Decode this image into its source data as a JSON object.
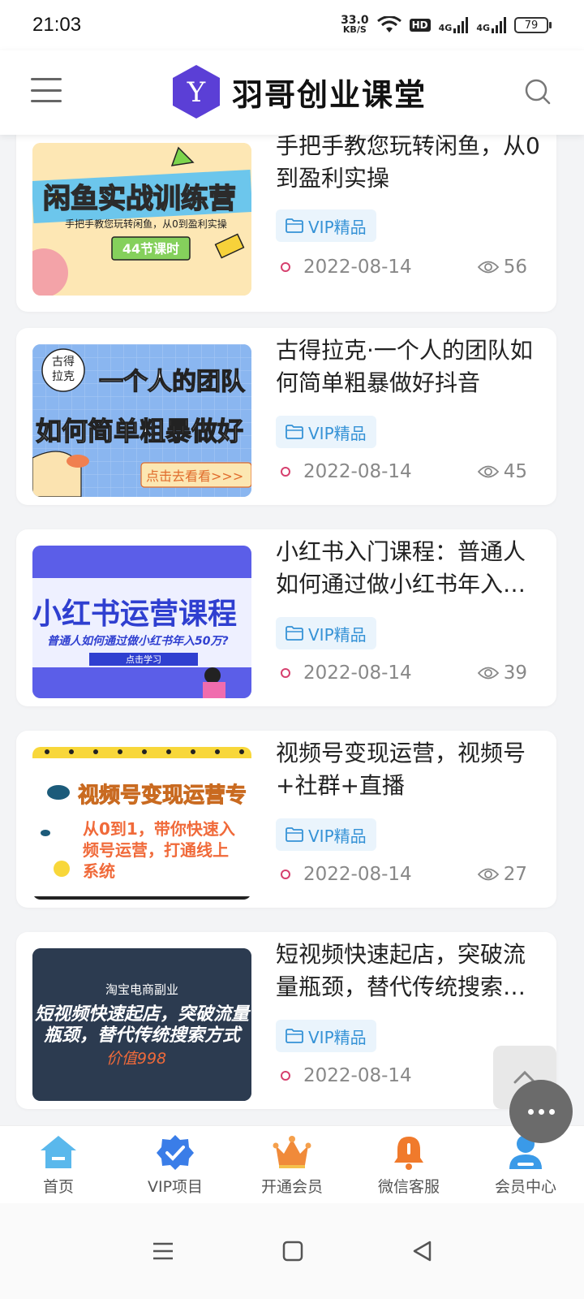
{
  "status_bar": {
    "time": "21:03",
    "net_speed_value": "33.0",
    "net_speed_unit": "KB/S",
    "hd_label": "HD",
    "signal_1": "4G",
    "signal_2": "4G",
    "battery": "79"
  },
  "header": {
    "logo_letter": "Y",
    "title": "羽哥创业课堂"
  },
  "posts": [
    {
      "thumb_banner": "闲鱼实战训练营",
      "thumb_sub": "手把手教您玩转闲鱼，从0到盈利实操",
      "thumb_badge": "44节课时",
      "title": "手把手教您玩转闲鱼，从0到盈利实操",
      "tag": "VIP精品",
      "date": "2022-08-14",
      "views": "56"
    },
    {
      "thumb_top": "古得\n拉克",
      "thumb_banner": "一个人的团队",
      "thumb_sub": "如何简单粗暴做好",
      "thumb_badge": "点击去看看>>>",
      "title": "古得拉克·一个人的团队如何简单粗暴做好抖音",
      "tag": "VIP精品",
      "date": "2022-08-14",
      "views": "45"
    },
    {
      "thumb_banner": "小红书运营课程",
      "thumb_sub": "普通人如何通过做小红书年入50万?",
      "thumb_badge": "点击学习",
      "title": "小红书入门课程：普通人如何通过做小红书年入…",
      "tag": "VIP精品",
      "date": "2022-08-14",
      "views": "39"
    },
    {
      "thumb_banner": "视频号变现运营专",
      "thumb_sub": "从0到1，带你快速入",
      "thumb_sub2": "频号运营，打通线上",
      "thumb_sub3": "系统",
      "title": "视频号变现运营，视频号+社群+直播",
      "tag": "VIP精品",
      "date": "2022-08-14",
      "views": "27"
    },
    {
      "thumb_top": "淘宝电商副业",
      "thumb_banner": "短视频快速起店，突破流量",
      "thumb_sub": "瓶颈，替代传统搜索方式",
      "thumb_badge": "价值998",
      "title": "短视频快速起店，突破流量瓶颈，替代传统搜索…",
      "tag": "VIP精品",
      "date": "2022-08-14",
      "views": ""
    }
  ],
  "tabs": [
    {
      "label": "首页",
      "icon": "home-icon"
    },
    {
      "label": "VIP项目",
      "icon": "vip-badge-icon"
    },
    {
      "label": "开通会员",
      "icon": "crown-icon"
    },
    {
      "label": "微信客服",
      "icon": "bell-icon"
    },
    {
      "label": "会员中心",
      "icon": "user-icon"
    }
  ],
  "colors": {
    "accent": "#3592d6",
    "logo": "#5b3fd6",
    "date_dot": "#d6406e"
  }
}
